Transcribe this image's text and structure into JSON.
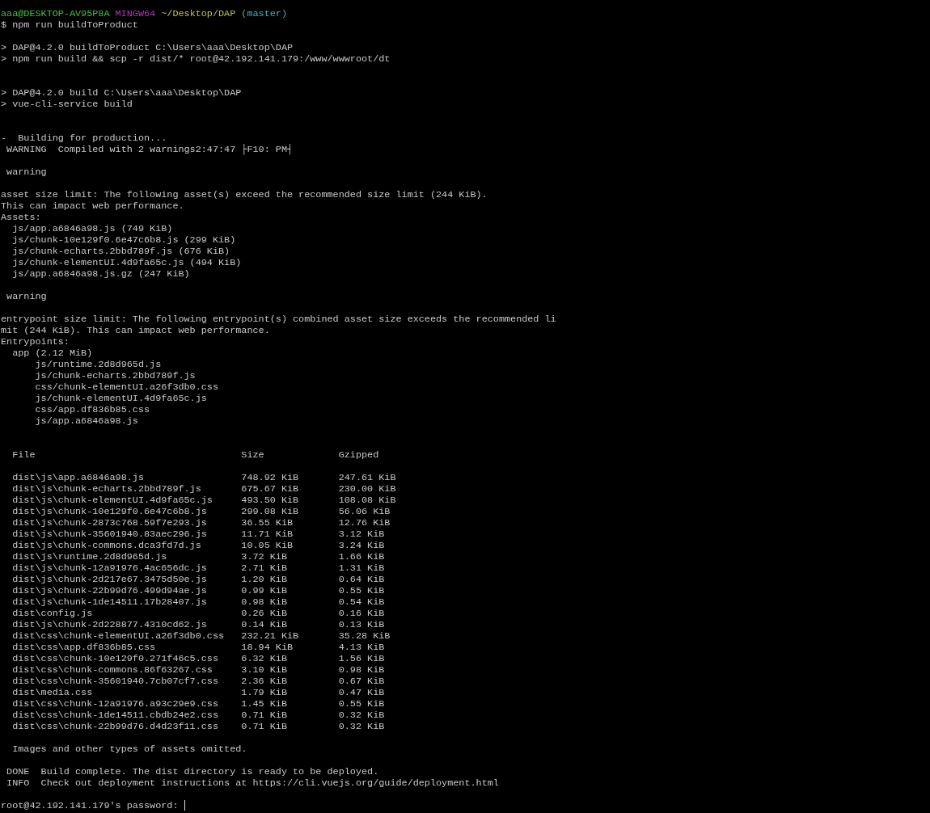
{
  "terminal": {
    "lines": [
      {
        "kind": "prompt",
        "segments": [
          {
            "text": "aaa@DESKTOP-AV95P8A",
            "color": "#3fc23f"
          },
          {
            "text": "MINGW64",
            "color": "#c22fc2"
          },
          {
            "text": "~/Desktop/DAP",
            "color": "#c2c23f"
          },
          {
            "text": "(master)",
            "color": "#3fb4c2"
          }
        ]
      },
      {
        "kind": "text",
        "text": "$ npm run buildToProduct"
      },
      {
        "kind": "blank"
      },
      {
        "kind": "text",
        "text": "> DAP@4.2.0 buildToProduct C:\\Users\\aaa\\Desktop\\DAP"
      },
      {
        "kind": "text",
        "text": "> npm run build && scp -r dist/* root@42.192.141.179:/www/wwwroot/dt"
      },
      {
        "kind": "blank"
      },
      {
        "kind": "blank"
      },
      {
        "kind": "text",
        "text": "> DAP@4.2.0 build C:\\Users\\aaa\\Desktop\\DAP"
      },
      {
        "kind": "text",
        "text": "> vue-cli-service build"
      },
      {
        "kind": "blank"
      },
      {
        "kind": "blank"
      },
      {
        "kind": "text",
        "text": "-  Building for production..."
      },
      {
        "kind": "text",
        "text": " WARNING  Compiled with 2 warnings2:47:47 ├F10: PM┤"
      },
      {
        "kind": "blank"
      },
      {
        "kind": "text",
        "text": " warning"
      },
      {
        "kind": "blank"
      },
      {
        "kind": "text",
        "text": "asset size limit: The following asset(s) exceed the recommended size limit (244 KiB)."
      },
      {
        "kind": "text",
        "text": "This can impact web performance."
      },
      {
        "kind": "text",
        "text": "Assets:"
      },
      {
        "kind": "text",
        "text": "  js/app.a6846a98.js (749 KiB)"
      },
      {
        "kind": "text",
        "text": "  js/chunk-10e129f0.6e47c6b8.js (299 KiB)"
      },
      {
        "kind": "text",
        "text": "  js/chunk-echarts.2bbd789f.js (676 KiB)"
      },
      {
        "kind": "text",
        "text": "  js/chunk-elementUI.4d9fa65c.js (494 KiB)"
      },
      {
        "kind": "text",
        "text": "  js/app.a6846a98.js.gz (247 KiB)"
      },
      {
        "kind": "blank"
      },
      {
        "kind": "text",
        "text": " warning"
      },
      {
        "kind": "blank"
      },
      {
        "kind": "text",
        "text": "entrypoint size limit: The following entrypoint(s) combined asset size exceeds the recommended li"
      },
      {
        "kind": "text",
        "text": "mit (244 KiB). This can impact web performance."
      },
      {
        "kind": "text",
        "text": "Entrypoints:"
      },
      {
        "kind": "text",
        "text": "  app (2.12 MiB)"
      },
      {
        "kind": "text",
        "text": "      js/runtime.2d8d965d.js"
      },
      {
        "kind": "text",
        "text": "      js/chunk-echarts.2bbd789f.js"
      },
      {
        "kind": "text",
        "text": "      css/chunk-elementUI.a26f3db0.css"
      },
      {
        "kind": "text",
        "text": "      js/chunk-elementUI.4d9fa65c.js"
      },
      {
        "kind": "text",
        "text": "      css/app.df836b85.css"
      },
      {
        "kind": "text",
        "text": "      js/app.a6846a98.js"
      },
      {
        "kind": "blank"
      },
      {
        "kind": "blank"
      },
      {
        "kind": "table_header",
        "cells": [
          "File",
          "Size",
          "Gzipped"
        ]
      },
      {
        "kind": "blank"
      },
      {
        "kind": "table_row",
        "cells": [
          "dist\\js\\app.a6846a98.js",
          "748.92 KiB",
          "247.61 KiB"
        ]
      },
      {
        "kind": "table_row",
        "cells": [
          "dist\\js\\chunk-echarts.2bbd789f.js",
          "675.67 KiB",
          "230.00 KiB"
        ]
      },
      {
        "kind": "table_row",
        "cells": [
          "dist\\js\\chunk-elementUI.4d9fa65c.js",
          "493.50 KiB",
          "108.08 KiB"
        ]
      },
      {
        "kind": "table_row",
        "cells": [
          "dist\\js\\chunk-10e129f0.6e47c6b8.js",
          "299.08 KiB",
          "56.06 KiB"
        ]
      },
      {
        "kind": "table_row",
        "cells": [
          "dist\\js\\chunk-2873c768.59f7e293.js",
          "36.55 KiB",
          "12.76 KiB"
        ]
      },
      {
        "kind": "table_row",
        "cells": [
          "dist\\js\\chunk-35601940.83aec296.js",
          "11.71 KiB",
          "3.12 KiB"
        ]
      },
      {
        "kind": "table_row",
        "cells": [
          "dist\\js\\chunk-commons.dca3fd7d.js",
          "10.05 KiB",
          "3.24 KiB"
        ]
      },
      {
        "kind": "table_row",
        "cells": [
          "dist\\js\\runtime.2d8d965d.js",
          "3.72 KiB",
          "1.66 KiB"
        ]
      },
      {
        "kind": "table_row",
        "cells": [
          "dist\\js\\chunk-12a91976.4ac656dc.js",
          "2.71 KiB",
          "1.31 KiB"
        ]
      },
      {
        "kind": "table_row",
        "cells": [
          "dist\\js\\chunk-2d217e67.3475d50e.js",
          "1.20 KiB",
          "0.64 KiB"
        ]
      },
      {
        "kind": "table_row",
        "cells": [
          "dist\\js\\chunk-22b99d76.499d94ae.js",
          "0.99 KiB",
          "0.55 KiB"
        ]
      },
      {
        "kind": "table_row",
        "cells": [
          "dist\\js\\chunk-1de14511.17b28407.js",
          "0.98 KiB",
          "0.54 KiB"
        ]
      },
      {
        "kind": "table_row",
        "cells": [
          "dist\\config.js",
          "0.26 KiB",
          "0.16 KiB"
        ]
      },
      {
        "kind": "table_row",
        "cells": [
          "dist\\js\\chunk-2d228877.4310cd62.js",
          "0.14 KiB",
          "0.13 KiB"
        ]
      },
      {
        "kind": "table_row",
        "cells": [
          "dist\\css\\chunk-elementUI.a26f3db0.css",
          "232.21 KiB",
          "35.28 KiB"
        ]
      },
      {
        "kind": "table_row",
        "cells": [
          "dist\\css\\app.df836b85.css",
          "18.94 KiB",
          "4.13 KiB"
        ]
      },
      {
        "kind": "table_row",
        "cells": [
          "dist\\css\\chunk-10e129f0.271f46c5.css",
          "6.32 KiB",
          "1.56 KiB"
        ]
      },
      {
        "kind": "table_row",
        "cells": [
          "dist\\css\\chunk-commons.86f63267.css",
          "3.10 KiB",
          "0.98 KiB"
        ]
      },
      {
        "kind": "table_row",
        "cells": [
          "dist\\css\\chunk-35601940.7cb07cf7.css",
          "2.36 KiB",
          "0.67 KiB"
        ]
      },
      {
        "kind": "table_row",
        "cells": [
          "dist\\media.css",
          "1.79 KiB",
          "0.47 KiB"
        ]
      },
      {
        "kind": "table_row",
        "cells": [
          "dist\\css\\chunk-12a91976.a93c29e9.css",
          "1.45 KiB",
          "0.55 KiB"
        ]
      },
      {
        "kind": "table_row",
        "cells": [
          "dist\\css\\chunk-1de14511.cbdb24e2.css",
          "0.71 KiB",
          "0.32 KiB"
        ]
      },
      {
        "kind": "table_row",
        "cells": [
          "dist\\css\\chunk-22b99d76.d4d23f11.css",
          "0.71 KiB",
          "0.32 KiB"
        ]
      },
      {
        "kind": "blank"
      },
      {
        "kind": "text",
        "text": "  Images and other types of assets omitted."
      },
      {
        "kind": "blank"
      },
      {
        "kind": "text",
        "text": " DONE  Build complete. The dist directory is ready to be deployed."
      },
      {
        "kind": "text",
        "text": " INFO  Check out deployment instructions at https://cli.vuejs.org/guide/deployment.html"
      },
      {
        "kind": "blank"
      },
      {
        "kind": "input",
        "text": "root@42.192.141.179's password:"
      }
    ]
  }
}
